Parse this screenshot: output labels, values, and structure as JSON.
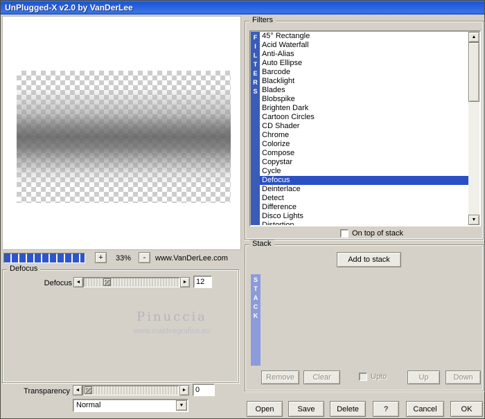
{
  "colors": {
    "titlebar_blue": "#2a63e0",
    "dialog_bg": "#d5d1c8",
    "selection_blue": "#2b4fc4",
    "filters_strip_blue": "#3a5cb8",
    "stack_strip_blue": "#8c9bdc",
    "progress_blue": "#2f55c8"
  },
  "icons": {
    "left_arrow": "◄",
    "right_arrow": "►",
    "up_arrow": "▲",
    "down_arrow": "▼",
    "dropdown_arrow": "▼"
  },
  "window": {
    "title": "UnPlugged-X v2.0 by VanDerLee"
  },
  "zoom": {
    "increase": "+",
    "level": "33%",
    "decrease": "-",
    "website": "www.VanDerLee.com"
  },
  "filter_params": {
    "group_title": "Defocus",
    "slider_label": "Defocus",
    "slider_value": "12",
    "watermark_name": "Pinuccia",
    "watermark_site": "www.maidiregrafica.eu"
  },
  "transparency": {
    "label": "Transparency",
    "value": "0",
    "blend_mode": "Normal"
  },
  "filters": {
    "group_title": "Filters",
    "strip_label": "FILTERS",
    "selected": "Defocus",
    "on_top_label": "On top of stack",
    "items": [
      "45° Rectangle",
      "Acid Waterfall",
      "Anti-Alias",
      "Auto Ellipse",
      "Barcode",
      "Blacklight",
      "Blades",
      "Blobspike",
      "Brighten Dark",
      "Cartoon Circles",
      "CD Shader",
      "Chrome",
      "Colorize",
      "Compose",
      "Copystar",
      "Cycle",
      "Defocus",
      "Deinterlace",
      "Detect",
      "Difference",
      "Disco Lights",
      "Distortion"
    ]
  },
  "stack": {
    "group_title": "Stack",
    "strip_label": "STACK",
    "add_label": "Add to stack",
    "remove_label": "Remove",
    "clear_label": "Clear",
    "upto_label": "Upto",
    "up_label": "Up",
    "down_label": "Down"
  },
  "actions": {
    "open": "Open",
    "save": "Save",
    "delete": "Delete",
    "help": "?",
    "cancel": "Cancel",
    "ok": "OK"
  }
}
